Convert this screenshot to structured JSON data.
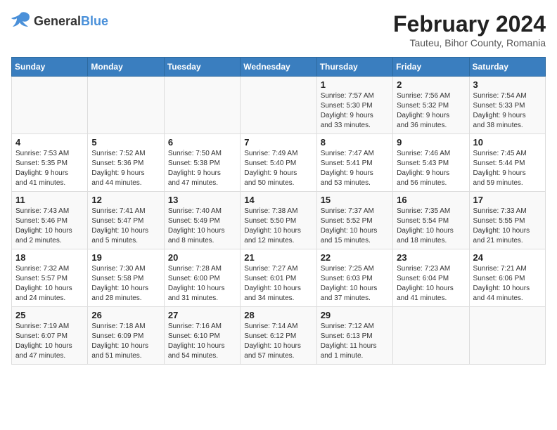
{
  "logo": {
    "general": "General",
    "blue": "Blue"
  },
  "title": "February 2024",
  "subtitle": "Tauteu, Bihor County, Romania",
  "days_of_week": [
    "Sunday",
    "Monday",
    "Tuesday",
    "Wednesday",
    "Thursday",
    "Friday",
    "Saturday"
  ],
  "weeks": [
    [
      {
        "day": "",
        "content": ""
      },
      {
        "day": "",
        "content": ""
      },
      {
        "day": "",
        "content": ""
      },
      {
        "day": "",
        "content": ""
      },
      {
        "day": "1",
        "content": "Sunrise: 7:57 AM\nSunset: 5:30 PM\nDaylight: 9 hours\nand 33 minutes."
      },
      {
        "day": "2",
        "content": "Sunrise: 7:56 AM\nSunset: 5:32 PM\nDaylight: 9 hours\nand 36 minutes."
      },
      {
        "day": "3",
        "content": "Sunrise: 7:54 AM\nSunset: 5:33 PM\nDaylight: 9 hours\nand 38 minutes."
      }
    ],
    [
      {
        "day": "4",
        "content": "Sunrise: 7:53 AM\nSunset: 5:35 PM\nDaylight: 9 hours\nand 41 minutes."
      },
      {
        "day": "5",
        "content": "Sunrise: 7:52 AM\nSunset: 5:36 PM\nDaylight: 9 hours\nand 44 minutes."
      },
      {
        "day": "6",
        "content": "Sunrise: 7:50 AM\nSunset: 5:38 PM\nDaylight: 9 hours\nand 47 minutes."
      },
      {
        "day": "7",
        "content": "Sunrise: 7:49 AM\nSunset: 5:40 PM\nDaylight: 9 hours\nand 50 minutes."
      },
      {
        "day": "8",
        "content": "Sunrise: 7:47 AM\nSunset: 5:41 PM\nDaylight: 9 hours\nand 53 minutes."
      },
      {
        "day": "9",
        "content": "Sunrise: 7:46 AM\nSunset: 5:43 PM\nDaylight: 9 hours\nand 56 minutes."
      },
      {
        "day": "10",
        "content": "Sunrise: 7:45 AM\nSunset: 5:44 PM\nDaylight: 9 hours\nand 59 minutes."
      }
    ],
    [
      {
        "day": "11",
        "content": "Sunrise: 7:43 AM\nSunset: 5:46 PM\nDaylight: 10 hours\nand 2 minutes."
      },
      {
        "day": "12",
        "content": "Sunrise: 7:41 AM\nSunset: 5:47 PM\nDaylight: 10 hours\nand 5 minutes."
      },
      {
        "day": "13",
        "content": "Sunrise: 7:40 AM\nSunset: 5:49 PM\nDaylight: 10 hours\nand 8 minutes."
      },
      {
        "day": "14",
        "content": "Sunrise: 7:38 AM\nSunset: 5:50 PM\nDaylight: 10 hours\nand 12 minutes."
      },
      {
        "day": "15",
        "content": "Sunrise: 7:37 AM\nSunset: 5:52 PM\nDaylight: 10 hours\nand 15 minutes."
      },
      {
        "day": "16",
        "content": "Sunrise: 7:35 AM\nSunset: 5:54 PM\nDaylight: 10 hours\nand 18 minutes."
      },
      {
        "day": "17",
        "content": "Sunrise: 7:33 AM\nSunset: 5:55 PM\nDaylight: 10 hours\nand 21 minutes."
      }
    ],
    [
      {
        "day": "18",
        "content": "Sunrise: 7:32 AM\nSunset: 5:57 PM\nDaylight: 10 hours\nand 24 minutes."
      },
      {
        "day": "19",
        "content": "Sunrise: 7:30 AM\nSunset: 5:58 PM\nDaylight: 10 hours\nand 28 minutes."
      },
      {
        "day": "20",
        "content": "Sunrise: 7:28 AM\nSunset: 6:00 PM\nDaylight: 10 hours\nand 31 minutes."
      },
      {
        "day": "21",
        "content": "Sunrise: 7:27 AM\nSunset: 6:01 PM\nDaylight: 10 hours\nand 34 minutes."
      },
      {
        "day": "22",
        "content": "Sunrise: 7:25 AM\nSunset: 6:03 PM\nDaylight: 10 hours\nand 37 minutes."
      },
      {
        "day": "23",
        "content": "Sunrise: 7:23 AM\nSunset: 6:04 PM\nDaylight: 10 hours\nand 41 minutes."
      },
      {
        "day": "24",
        "content": "Sunrise: 7:21 AM\nSunset: 6:06 PM\nDaylight: 10 hours\nand 44 minutes."
      }
    ],
    [
      {
        "day": "25",
        "content": "Sunrise: 7:19 AM\nSunset: 6:07 PM\nDaylight: 10 hours\nand 47 minutes."
      },
      {
        "day": "26",
        "content": "Sunrise: 7:18 AM\nSunset: 6:09 PM\nDaylight: 10 hours\nand 51 minutes."
      },
      {
        "day": "27",
        "content": "Sunrise: 7:16 AM\nSunset: 6:10 PM\nDaylight: 10 hours\nand 54 minutes."
      },
      {
        "day": "28",
        "content": "Sunrise: 7:14 AM\nSunset: 6:12 PM\nDaylight: 10 hours\nand 57 minutes."
      },
      {
        "day": "29",
        "content": "Sunrise: 7:12 AM\nSunset: 6:13 PM\nDaylight: 11 hours\nand 1 minute."
      },
      {
        "day": "",
        "content": ""
      },
      {
        "day": "",
        "content": ""
      }
    ]
  ]
}
